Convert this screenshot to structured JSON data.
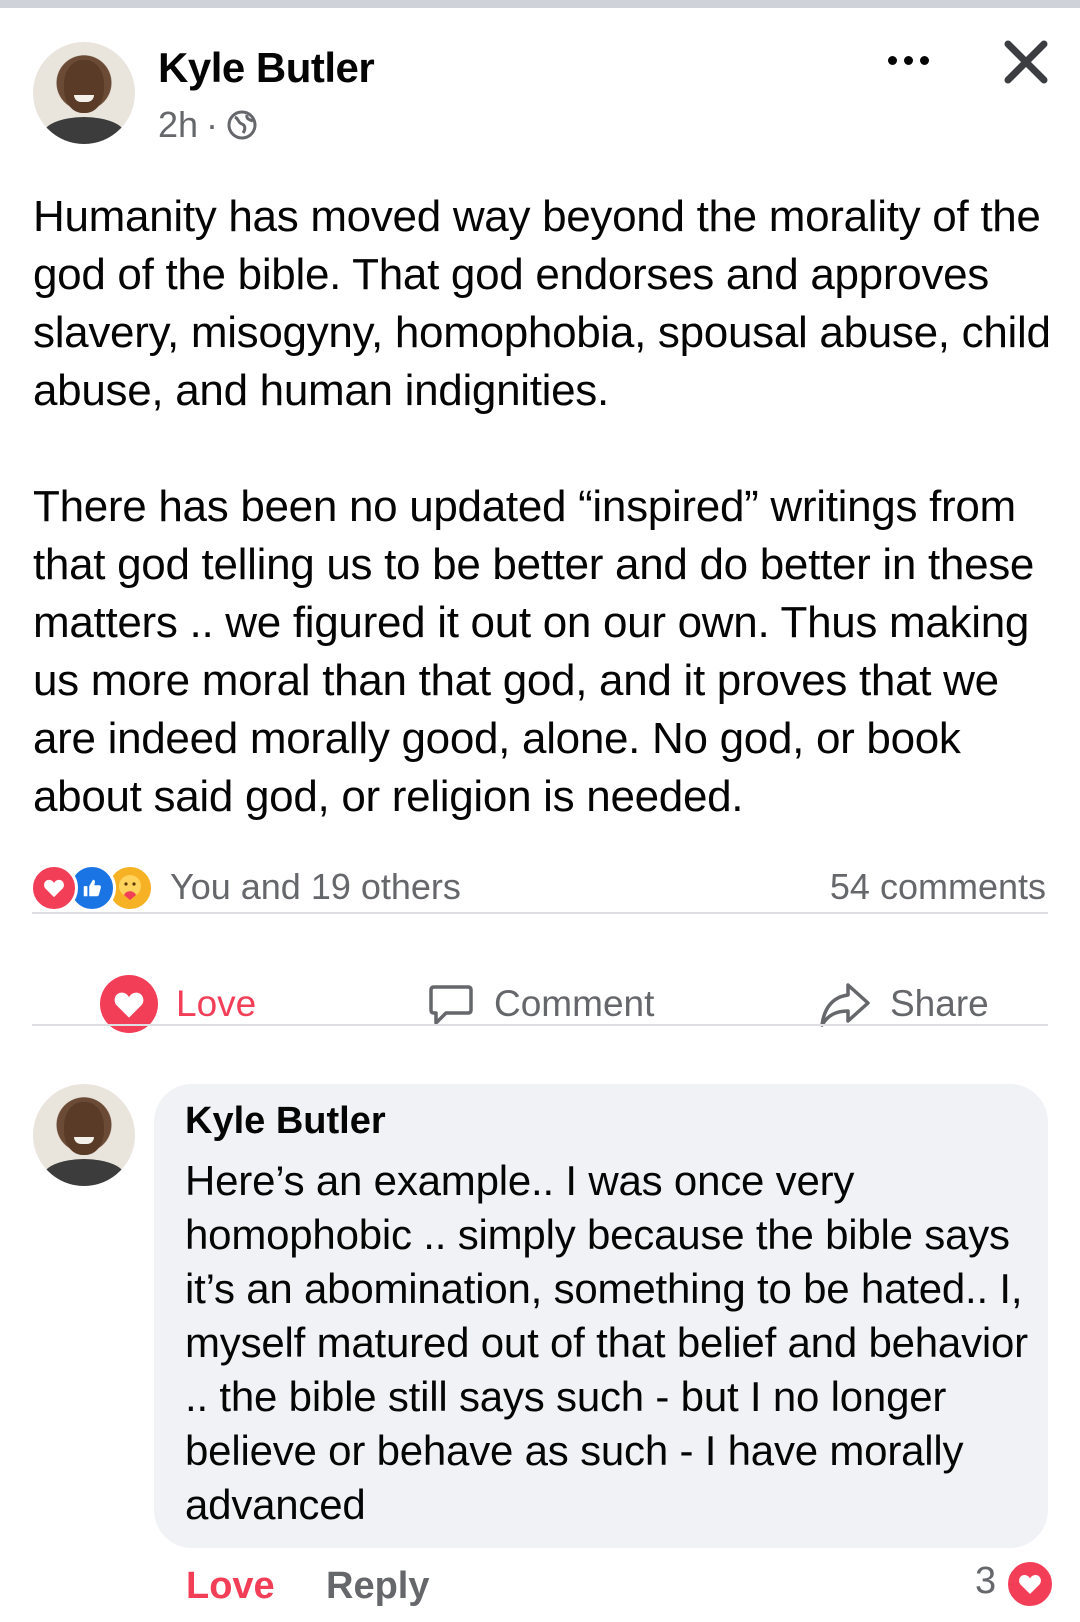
{
  "post": {
    "author": "Kyle Butler",
    "time": "2h",
    "separator": "·",
    "audience_icon": "globe-icon",
    "paragraphs": [
      "Humanity has moved way beyond the morality of the god of the bible.  That god endorses and approves slavery, misogyny, homophobia, spousal abuse, child abuse, and human indignities.",
      "There has been no updated “inspired” writings from that god telling us to be better and do better in these matters .. we figured it out on our own. Thus making us more moral than that god, and it proves that we are indeed morally good, alone. No god, or book about said god, or religion is needed."
    ],
    "reactions_icons": [
      "love-icon",
      "like-icon",
      "care-icon"
    ],
    "reactions_text": "You and 19 others",
    "comments_count": "54 comments"
  },
  "actions": {
    "love": "Love",
    "comment": "Comment",
    "share": "Share"
  },
  "comment": {
    "author": "Kyle Butler",
    "text": "Here’s an example.. I was once very homophobic .. simply because the bible says it’s an abomination, something to be hated.. I, myself matured out of that belief and behavior .. the bible still says such - but I no longer believe or behave as such - I have morally advanced",
    "love_label": "Love",
    "reply_label": "Reply",
    "reaction_count": "3"
  },
  "colors": {
    "love": "#f33e58",
    "like": "#1b74e4",
    "secondary_text": "#65676b",
    "bubble": "#f0f2f5"
  }
}
